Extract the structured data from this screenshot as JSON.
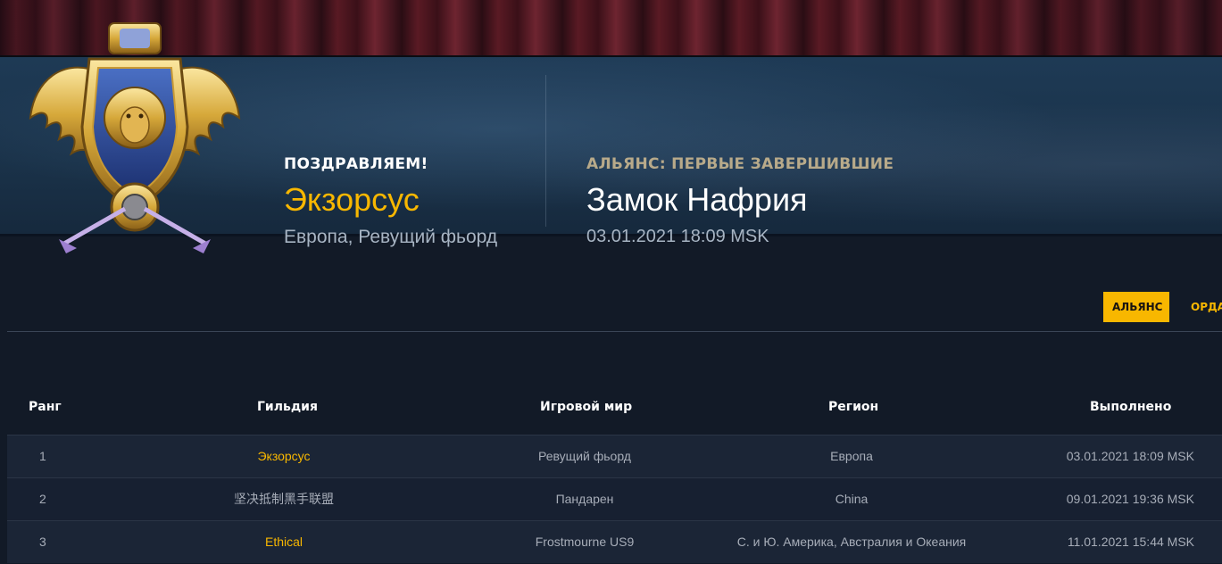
{
  "banner": {
    "congrats_label": "ПОЗДРАВЛЯЕМ!",
    "guild_name": "Экзорсус",
    "guild_realm": "Европа, Ревущий фьорд",
    "faction_first_label": "АЛЬЯНС: ПЕРВЫЕ ЗАВЕРШИВШИЕ",
    "raid_name": "Замок Нафрия",
    "completed_at": "03.01.2021 18:09 MSK",
    "crest_icon": "alliance-crest-icon"
  },
  "tabs": [
    {
      "label": "АЛЬЯНС",
      "active": true
    },
    {
      "label": "ОРДА",
      "active": false
    }
  ],
  "table": {
    "headers": {
      "rank": "Ранг",
      "guild": "Гильдия",
      "realm": "Игровой мир",
      "region": "Регион",
      "completed": "Выполнено"
    },
    "rows": [
      {
        "rank": "1",
        "guild": "Экзорсус",
        "guild_highlight": true,
        "realm": "Ревущий фьорд",
        "region": "Европа",
        "completed": "03.01.2021 18:09 MSK"
      },
      {
        "rank": "2",
        "guild": "坚决抵制黑手联盟",
        "guild_highlight": false,
        "realm": "Пандарен",
        "region": "China",
        "completed": "09.01.2021 19:36 MSK"
      },
      {
        "rank": "3",
        "guild": "Ethical",
        "guild_highlight": true,
        "realm": "Frostmourne US9",
        "region": "С. и Ю. Америка, Австралия и Океания",
        "completed": "11.01.2021 15:44 MSK"
      }
    ]
  },
  "colors": {
    "accent_gold": "#f8b700",
    "background": "#121a27",
    "banner_blue": "#1e3a55"
  }
}
